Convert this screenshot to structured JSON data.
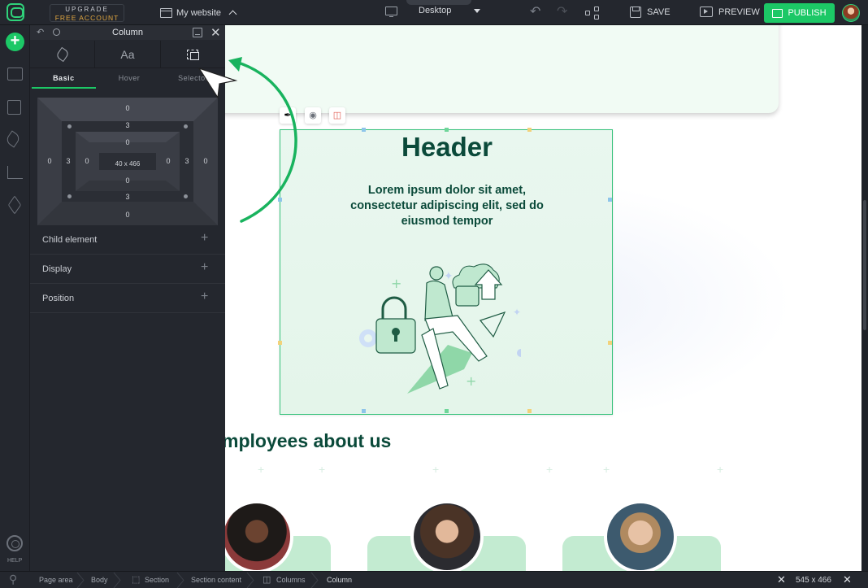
{
  "topbar": {
    "upgrade_line1": "UPGRADE",
    "upgrade_line2": "FREE ACCOUNT",
    "site_name": "My website",
    "device": "Desktop",
    "save_label": "SAVE",
    "preview_label": "PREVIEW",
    "publish_label": "PUBLISH"
  },
  "rail": {
    "help_label": "HELP"
  },
  "panel": {
    "title": "Column",
    "tabs": [
      {
        "icon": "brush-icon"
      },
      {
        "label": "Aa"
      },
      {
        "icon": "selection-icon"
      }
    ],
    "subtabs": [
      "Basic",
      "Hover",
      "Selector"
    ],
    "box_model": {
      "margin": {
        "top": "0",
        "right": "0",
        "bottom": "0",
        "left": "0"
      },
      "border": {
        "top": "3",
        "right": "3",
        "bottom": "3",
        "left": "3"
      },
      "padding": {
        "top": "0",
        "right": "0",
        "bottom": "0",
        "left": "0"
      },
      "size": "40 x 466"
    },
    "sections": [
      "Child element",
      "Display",
      "Position"
    ]
  },
  "canvas": {
    "header": "Header",
    "paragraph": "Lorem ipsum dolor sit amet, consectetur adipiscing elit, sed do eiusmod tempor",
    "employees_title": "mployees about us"
  },
  "bottombar": {
    "breadcrumbs": [
      "Page area",
      "Body",
      "Section",
      "Section content",
      "Columns",
      "Column"
    ],
    "size_readout": "545 x 466"
  },
  "colors": {
    "accent": "#1cc866",
    "dark_green_text": "#0b4a3a",
    "panel_bg": "#24272e",
    "column_bg": "#e9f7ef"
  }
}
